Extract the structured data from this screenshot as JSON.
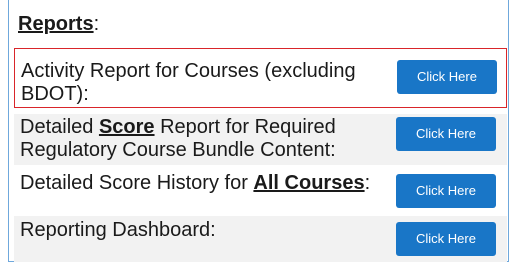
{
  "section": {
    "title": "Reports",
    "title_suffix": ":"
  },
  "rows": [
    {
      "label_line1": "Activity Report for Courses (excluding",
      "label_line2": "BDOT):",
      "button": "Click Here"
    },
    {
      "label_pre": "Detailed ",
      "label_bold": "Score",
      "label_post": " Report for Required",
      "label_line2": "Regulatory Course Bundle Content:",
      "button": "Click Here"
    },
    {
      "label_pre": "Detailed Score History for ",
      "label_bold": "All Courses",
      "label_post": ":",
      "button": "Click Here"
    },
    {
      "label": "Reporting Dashboard:",
      "button": "Click Here"
    }
  ],
  "colors": {
    "button_bg": "#1976c7",
    "highlight_border": "#d9252a",
    "panel_border": "#6fa8dc"
  }
}
